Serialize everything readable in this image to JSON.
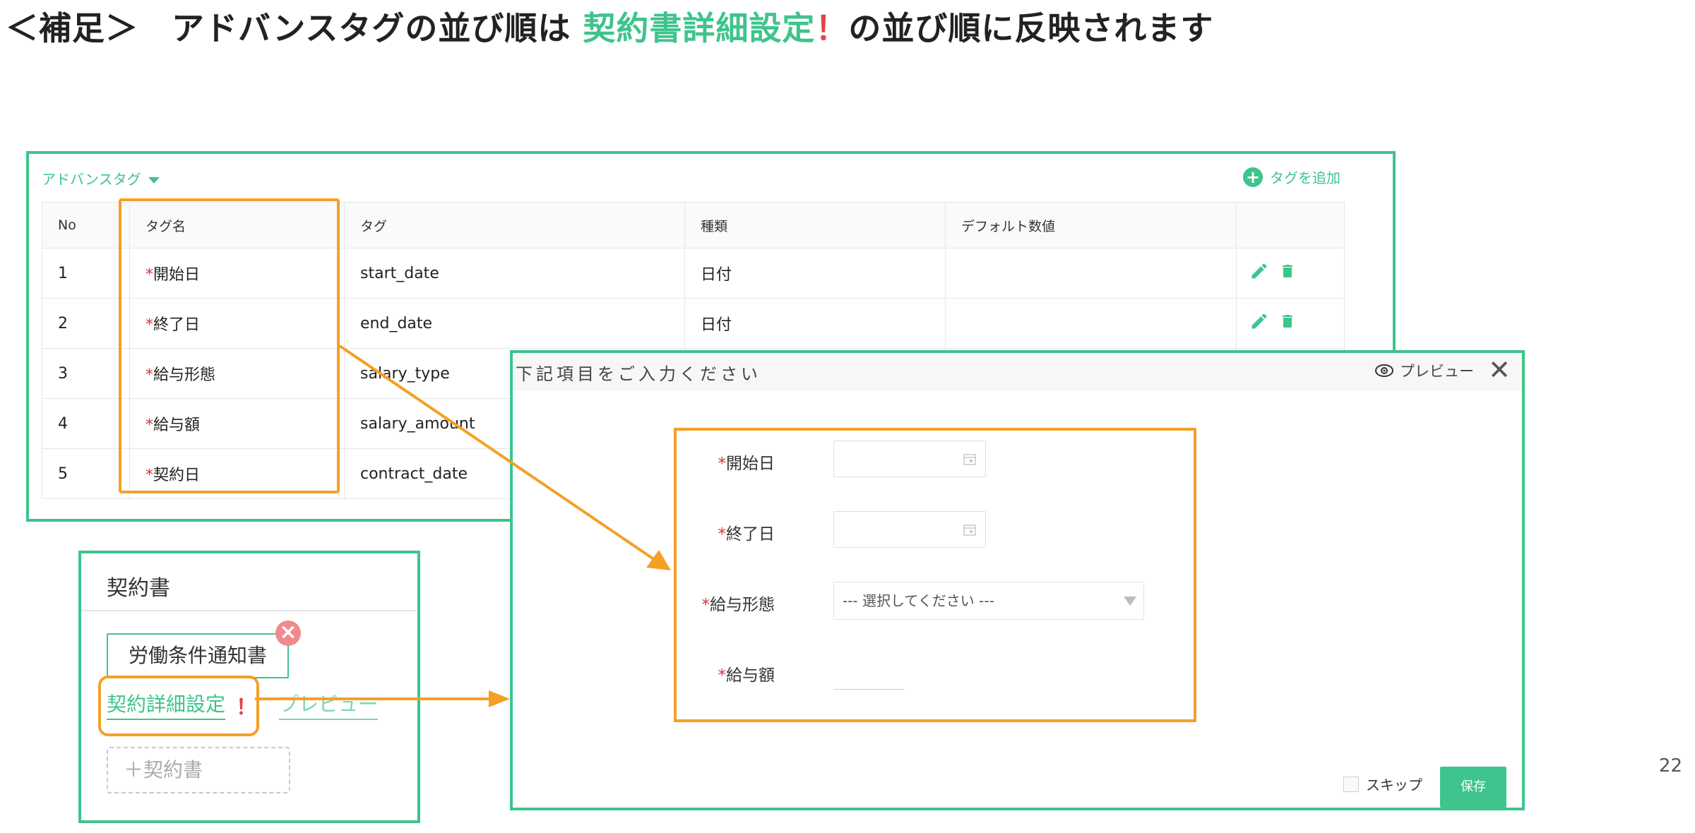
{
  "slide": {
    "title_pre": "＜補足＞　アドバンスタグの並び順は ",
    "title_accent": "契約書詳細設定",
    "title_bang": "！",
    "title_post": "の並び順に反映されます",
    "page_number": "22"
  },
  "advanced_tags": {
    "header": "アドバンスタグ",
    "add_tag_label": "タグを追加",
    "columns": [
      "No",
      "タグ名",
      "タグ",
      "種類",
      "デフォルト数値",
      ""
    ],
    "rows": [
      {
        "no": "1",
        "req": "*",
        "name": "開始日",
        "tag": "start_date",
        "type": "日付",
        "default": ""
      },
      {
        "no": "2",
        "req": "*",
        "name": "終了日",
        "tag": "end_date",
        "type": "日付",
        "default": ""
      },
      {
        "no": "3",
        "req": "*",
        "name": "給与形態",
        "tag": "salary_type",
        "type": "",
        "default": ""
      },
      {
        "no": "4",
        "req": "*",
        "name": "給与額",
        "tag": "salary_amount",
        "type": "",
        "default": ""
      },
      {
        "no": "5",
        "req": "*",
        "name": "契約日",
        "tag": "contract_date",
        "type": "",
        "default": ""
      }
    ]
  },
  "contract": {
    "title": "契約書",
    "document_tag": "労働条件通知書",
    "close_symbol": "×",
    "detail_link": "契約詳細設定",
    "detail_bang": "！",
    "preview_link": "プレビュー",
    "add_button": "＋契約書"
  },
  "form": {
    "header": "下記項目をご入力ください",
    "preview_label": "プレビュー",
    "close_symbol": "✕",
    "fields": [
      {
        "req": "*",
        "label": "開始日"
      },
      {
        "req": "*",
        "label": "終了日"
      },
      {
        "req": "*",
        "label": "給与形態",
        "placeholder": "--- 選択してください ---"
      },
      {
        "req": "*",
        "label": "給与額"
      }
    ],
    "skip_label": "スキップ",
    "save_label": "保存"
  },
  "colors": {
    "accent_green": "#3ec48c",
    "highlight_orange": "#f4a025",
    "required_red": "#d8333a"
  }
}
